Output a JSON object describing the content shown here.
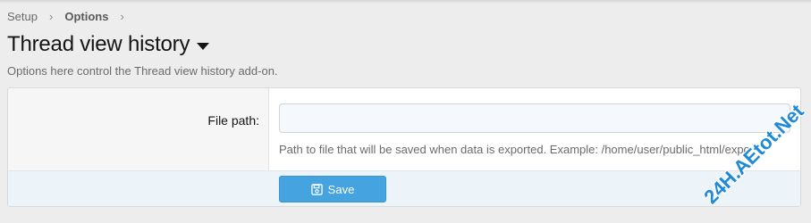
{
  "breadcrumb": {
    "items": [
      "Setup",
      "Options"
    ],
    "separator": "›"
  },
  "page": {
    "title": "Thread view history",
    "description": "Options here control the Thread view history add-on."
  },
  "form": {
    "file_path": {
      "label": "File path:",
      "value": "",
      "placeholder": "",
      "hint": "Path to file that will be saved when data is exported. Example: /home/user/public_html/expo"
    },
    "save_label": "Save"
  },
  "watermark": {
    "text": "24H.AEtot.Net"
  },
  "colors": {
    "accent": "#45a3e0",
    "footer_bg": "#ecf3f9",
    "page_bg": "#ededed"
  },
  "icons": {
    "title_menu": "caret-down-icon",
    "save": "floppy-disk-icon"
  }
}
